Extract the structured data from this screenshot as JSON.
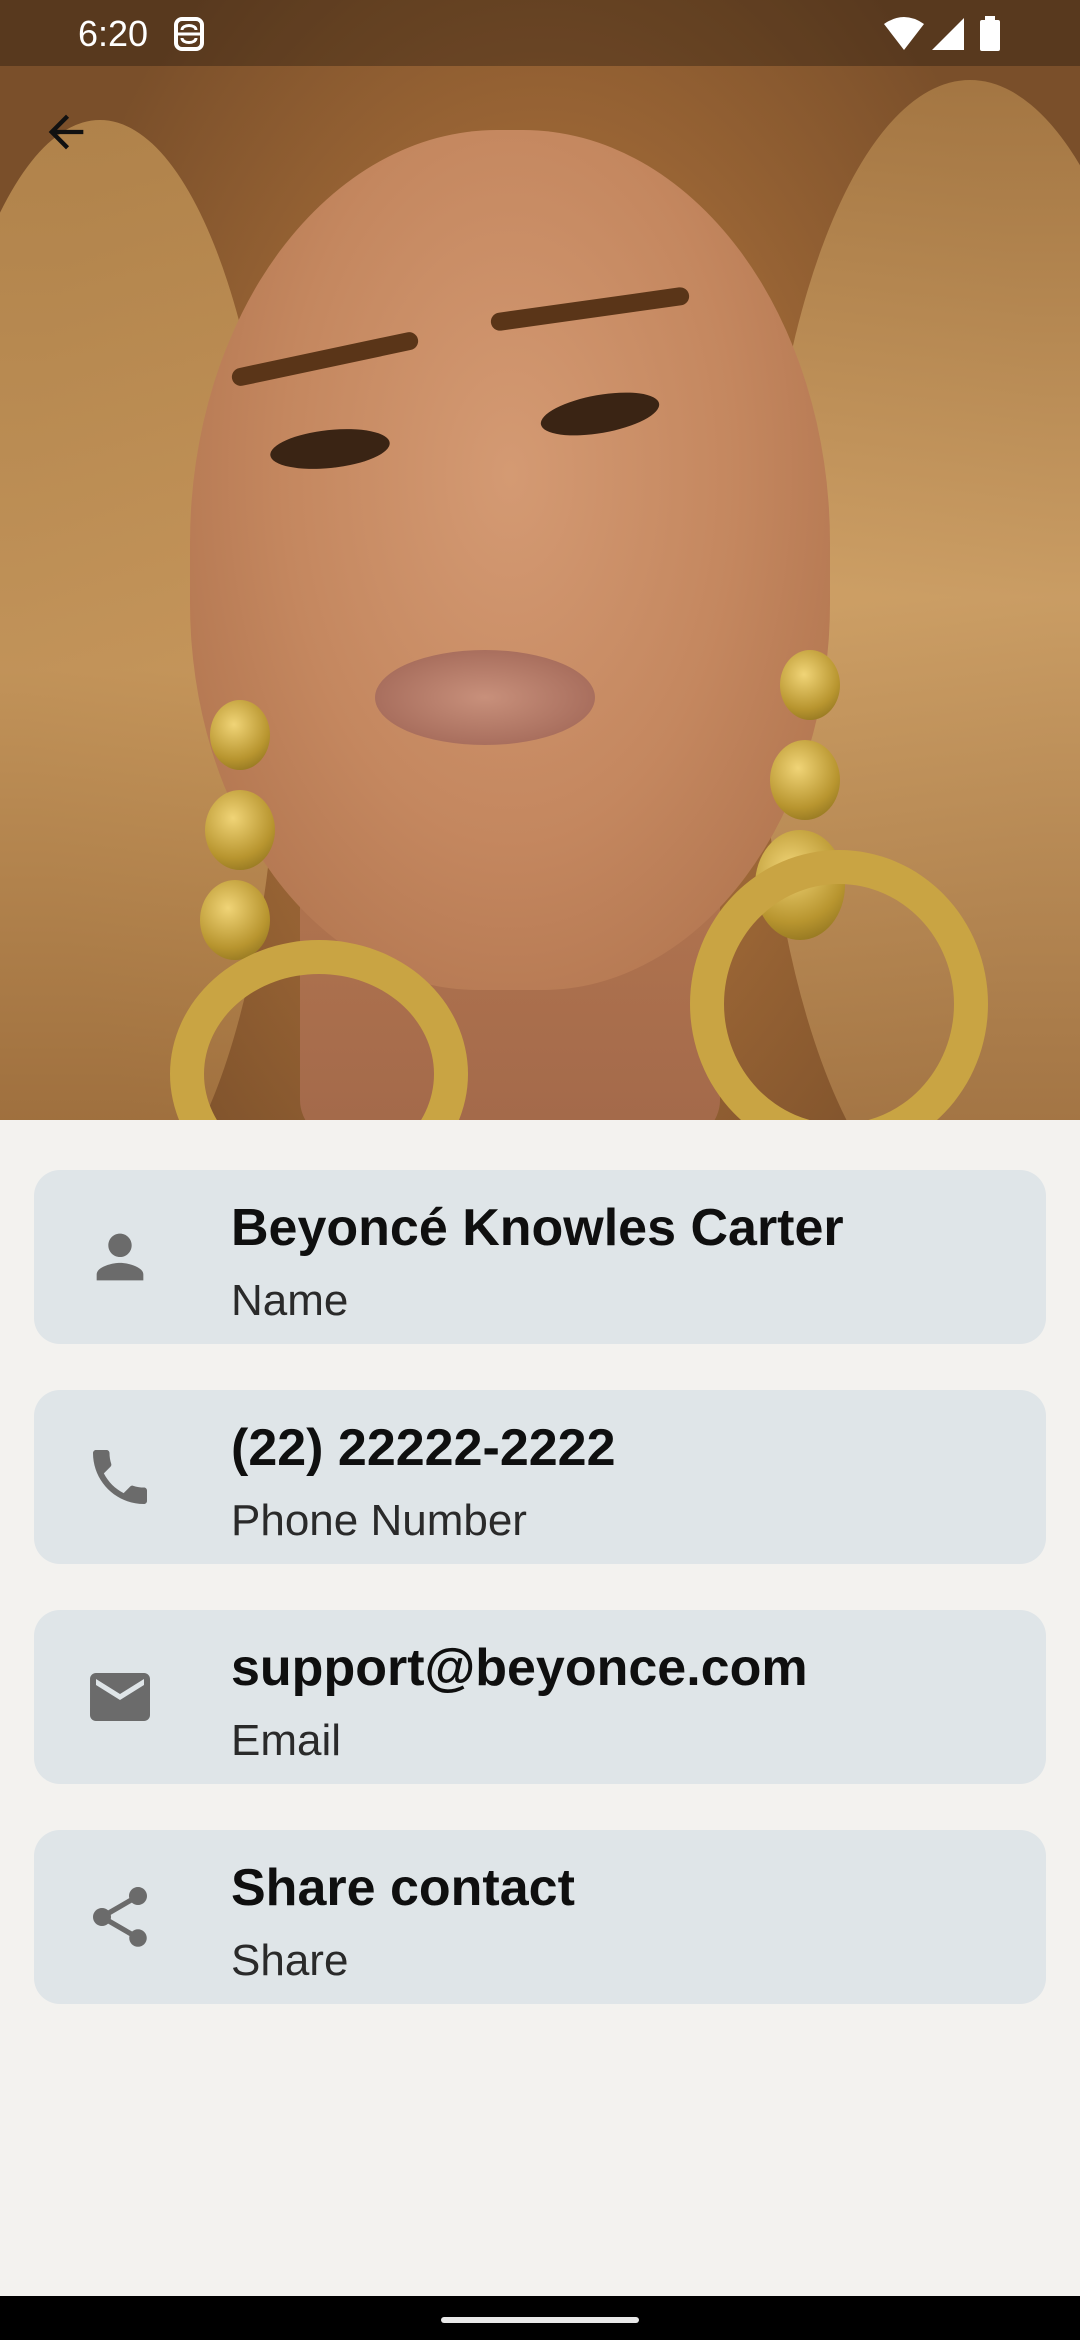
{
  "status_bar": {
    "time": "6:20"
  },
  "contact": {
    "name": "Beyoncé Knowles Carter",
    "name_label": "Name",
    "phone": "(22) 22222-2222",
    "phone_label": "Phone Number",
    "email": "support@beyonce.com",
    "email_label": "Email",
    "share_title": "Share contact",
    "share_label": "Share"
  },
  "icons": {
    "back": "arrow-back-icon",
    "name": "person-icon",
    "phone": "phone-icon",
    "email": "mail-icon",
    "share": "share-icon"
  },
  "colors": {
    "card_bg": "#dfe5e8",
    "page_bg": "#f3f2ef",
    "icon": "#6b6b6b"
  }
}
